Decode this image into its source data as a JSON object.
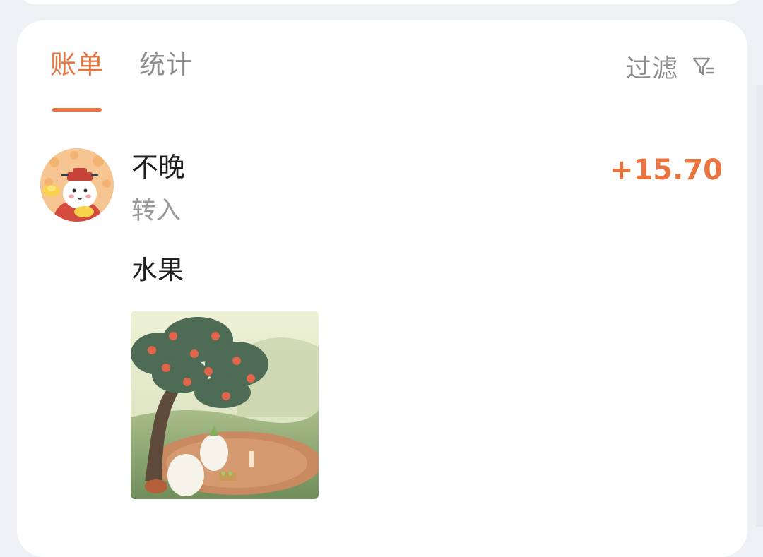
{
  "tabs": {
    "bills": "账单",
    "stats": "统计",
    "active": "bills"
  },
  "filter": {
    "label": "过滤",
    "icon": "filter-icon"
  },
  "transaction": {
    "name": "不晚",
    "type": "转入",
    "amount": "+15.70",
    "note": "水果",
    "avatar_icon": "cartoon-avatar",
    "photo_icon": "fruit-tree-illustration"
  },
  "colors": {
    "accent": "#e8753f",
    "muted_text": "#8c8c8c",
    "primary_text": "#1f1f1f",
    "background": "#eef0f4",
    "card": "#ffffff"
  }
}
